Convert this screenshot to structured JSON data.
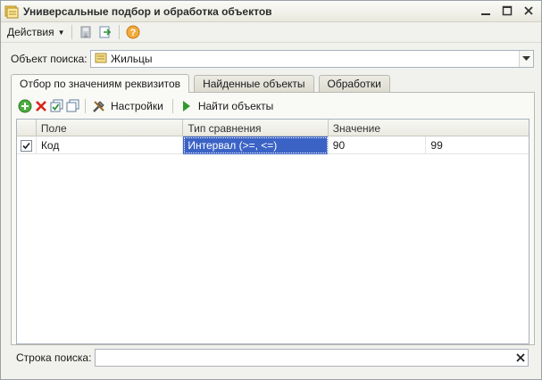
{
  "window": {
    "title": "Универсальные подбор и обработка объектов",
    "controls": [
      "minimize",
      "maximize",
      "close"
    ]
  },
  "toolbar": {
    "actions_label": "Действия",
    "icons": [
      "save-icon",
      "open-icon",
      "help-icon"
    ]
  },
  "search_object": {
    "label": "Объект поиска:",
    "value": "Жильцы",
    "icon": "catalog-icon"
  },
  "tabs": [
    {
      "label": "Отбор по значениям реквизитов",
      "active": true
    },
    {
      "label": "Найденные объекты",
      "active": false
    },
    {
      "label": "Обработки",
      "active": false
    }
  ],
  "panel_toolbar": {
    "settings_label": "Настройки",
    "find_label": "Найти объекты",
    "icons": [
      "add-icon",
      "delete-icon",
      "check-all-icon",
      "uncheck-all-icon",
      "settings-icon",
      "run-icon"
    ]
  },
  "table": {
    "columns": [
      "Поле",
      "Тип сравнения",
      "Значение"
    ],
    "rows": [
      {
        "checked": true,
        "field": "Код",
        "comparison": "Интервал (>=, <=)",
        "value_from": "90",
        "value_to": "99"
      }
    ]
  },
  "search_string": {
    "label": "Строка поиска:",
    "value": ""
  },
  "colors": {
    "selection": "#3b63c6",
    "background": "#f1f1ed"
  }
}
